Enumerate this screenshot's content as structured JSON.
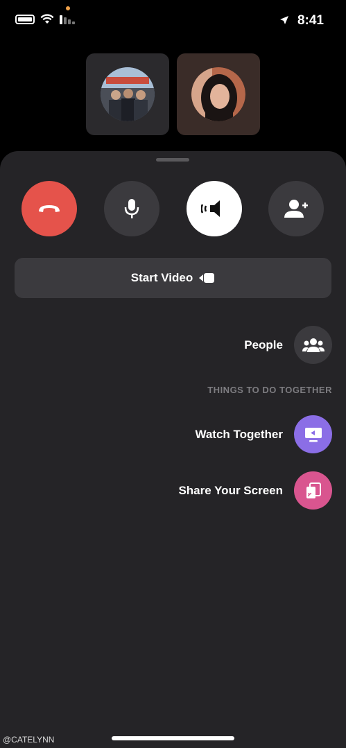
{
  "status_bar": {
    "time": "8:41"
  },
  "controls": [
    {
      "name": "end-call",
      "icon": "phone-hangup-icon",
      "color": "#e5534b"
    },
    {
      "name": "mute",
      "icon": "microphone-icon"
    },
    {
      "name": "speaker",
      "icon": "speaker-icon",
      "color": "#ffffff"
    },
    {
      "name": "add-person",
      "icon": "add-person-icon"
    }
  ],
  "start_video": {
    "label": "Start Video",
    "icon": "video-camera-icon"
  },
  "people": {
    "label": "People",
    "icon": "people-icon"
  },
  "section_header": "THINGS TO DO TOGETHER",
  "activities": [
    {
      "label": "Watch Together",
      "icon": "watch-together-icon",
      "color": "#8b6ee6"
    },
    {
      "label": "Share Your Screen",
      "icon": "share-screen-icon",
      "color": "#d9558f"
    }
  ],
  "watermark": "@CATELYNN"
}
